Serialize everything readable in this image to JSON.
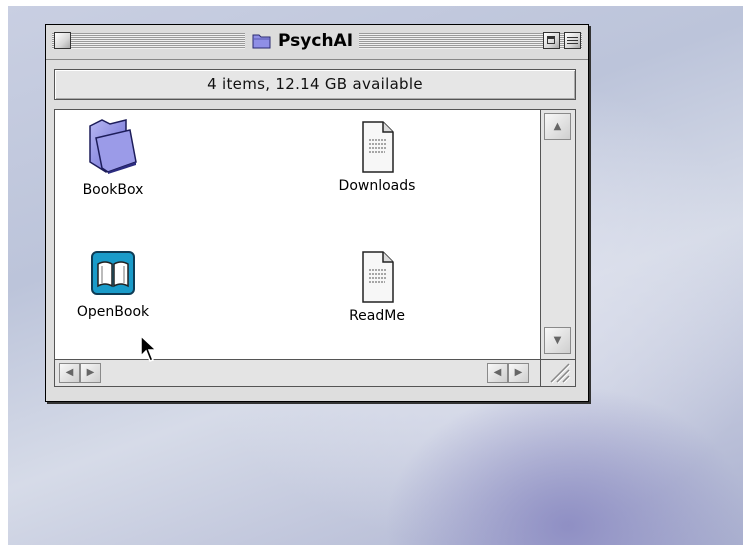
{
  "window": {
    "title": "PsychAI",
    "title_icon": "folder-icon",
    "header_status": "4 items, 12.14 GB available",
    "buttons": {
      "close": "close-box",
      "zoom": "zoom-box",
      "collapse": "collapse-box"
    }
  },
  "items": [
    {
      "label": "BookBox",
      "icon": "folder-icon"
    },
    {
      "label": "Downloads",
      "icon": "document-icon"
    },
    {
      "label": "OpenBook",
      "icon": "open-book-app-icon",
      "selected": true
    },
    {
      "label": "ReadMe",
      "icon": "document-icon"
    }
  ],
  "colors": {
    "folder": "#8f8fe6",
    "selection": "#1a9bc9",
    "window_bg": "#dedede"
  },
  "scrollbars": {
    "vertical": {
      "up": "up-arrow-icon",
      "down": "down-arrow-icon"
    },
    "horizontal": {
      "left": "left-arrow-icon",
      "right": "right-arrow-icon"
    }
  }
}
